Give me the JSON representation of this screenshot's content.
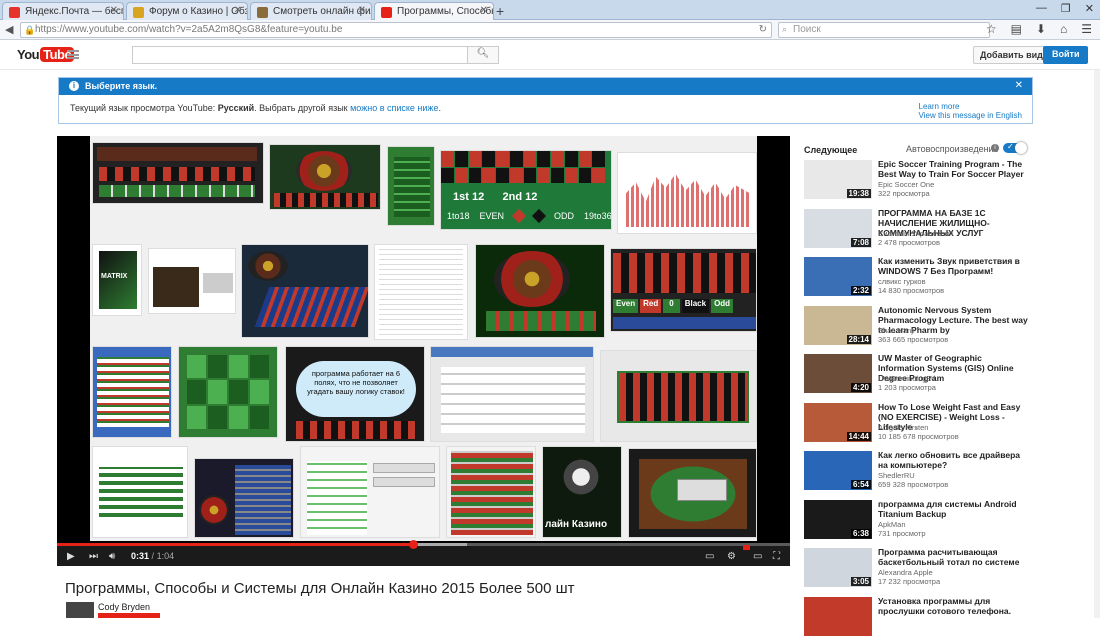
{
  "browser": {
    "tabs": [
      {
        "label": "Яндекс.Почта — бесплат...",
        "color": "#e5322d"
      },
      {
        "label": "Форум о Казино | Обзор к...",
        "color": "#d9a520"
      },
      {
        "label": "Смотреть онлайн фильма...",
        "color": "#8a6b3a"
      },
      {
        "label": "Программы, Способы и С...",
        "color": "#e62117"
      }
    ],
    "new_tab": "+",
    "url": "https://www.youtube.com/watch?v=2a5A2m8QsG8&feature=youtu.be",
    "search_placeholder": "Поиск"
  },
  "youtube": {
    "logo_you": "You",
    "logo_tube": "Tube",
    "upload_label": "Добавить видео",
    "signin_label": "Войти"
  },
  "alert": {
    "title": "Выберите язык.",
    "message_prefix": "Текущий язык просмотра YouTube: ",
    "current_language": "Русский",
    "message_mid": ". Выбрать другой язык ",
    "link_text": "можно в списке ниже",
    "message_suffix": ".",
    "learn_more": "Learn more",
    "view_english": "View this message in English"
  },
  "player": {
    "current_time": "0:31",
    "duration": "1:04",
    "played_fraction": 0.485,
    "loaded_fraction": 0.56
  },
  "video": {
    "title": "Программы, Способы и Системы для Онлайн Казино 2015 Более 500 шт",
    "channel": "Cody Bryden"
  },
  "sidebar": {
    "heading": "Следующее",
    "autoplay_label": "Автовоспроизведение",
    "items": [
      {
        "title": "Epic Soccer Training Program - The Best Way to Train For Soccer Player",
        "channel": "Epic Soccer One",
        "views": "322 просмотра",
        "duration": "19:38",
        "thumb": "#e8e8e8"
      },
      {
        "title": "ПРОГРАММА НА БАЗЕ 1С НАЧИСЛЕНИЕ ЖИЛИЩНО-КОММУНАЛЬНЫХ УСЛУГ",
        "channel": "Системы Управления",
        "views": "2 478 просмотров",
        "duration": "7:08",
        "thumb": "#d8dde3"
      },
      {
        "title": "Как изменить Звук приветствия в WINDOWS 7 Без Программ!",
        "channel": "слвикс гурков",
        "views": "14 830 просмотров",
        "duration": "2:32",
        "thumb": "#3a6fb5"
      },
      {
        "title": "Autonomic Nervous System Pharmacology Lecture. The best way to learn Pharm by",
        "channel": "Shan Nanji",
        "views": "363 665 просмотров",
        "duration": "28:14",
        "thumb": "#c9b893"
      },
      {
        "title": "UW Master of Geographic Information Systems (GIS) Online Degree Program",
        "channel": "UWContinuingEd",
        "views": "1 203 просмотра",
        "duration": "4:20",
        "thumb": "#6b4d3a"
      },
      {
        "title": "How To Lose Weight Fast and Easy (NO EXERCISE) - Weight Loss - Lifestyle -",
        "channel": "Abigale Kirsten",
        "views": "10 185 678 просмотров",
        "duration": "14:44",
        "thumb": "#b75a3a"
      },
      {
        "title": "Как легко обновить все драйвера на компьютере?",
        "channel": "ShedlerRU",
        "views": "659 328 просмотров",
        "duration": "6:54",
        "thumb": "#2a66b8"
      },
      {
        "title": "программа для системы Android Titanium Backup",
        "channel": "ApkMan",
        "views": "731 просмотр",
        "duration": "6:38",
        "thumb": "#1a1a1a"
      },
      {
        "title": "Программа расчитывающая баскетбольный тотал по системе",
        "channel": "Alexandra Apple",
        "views": "17 232 просмотра",
        "duration": "3:05",
        "thumb": "#cfd6de"
      },
      {
        "title": "Установка программы для прослушки сотового телефона.",
        "channel": "",
        "views": "",
        "duration": "",
        "thumb": "#c23a2a"
      }
    ]
  },
  "collage_labels": {
    "t1_title": "1st 12",
    "t1_title2": "2nd 12",
    "t1_even": "EVEN",
    "t1_odd": "ODD",
    "t1_c1": "1to18",
    "t1_c2": "19to36",
    "matrix": "MATRIX",
    "bubble": "программа работает на 6 полях, что не позволяет угадать вашу логику ставок!",
    "casino": "лайн Казино",
    "even": "Even",
    "red": "Red",
    "black": "Black",
    "odd": "Odd",
    "zero": "0"
  }
}
